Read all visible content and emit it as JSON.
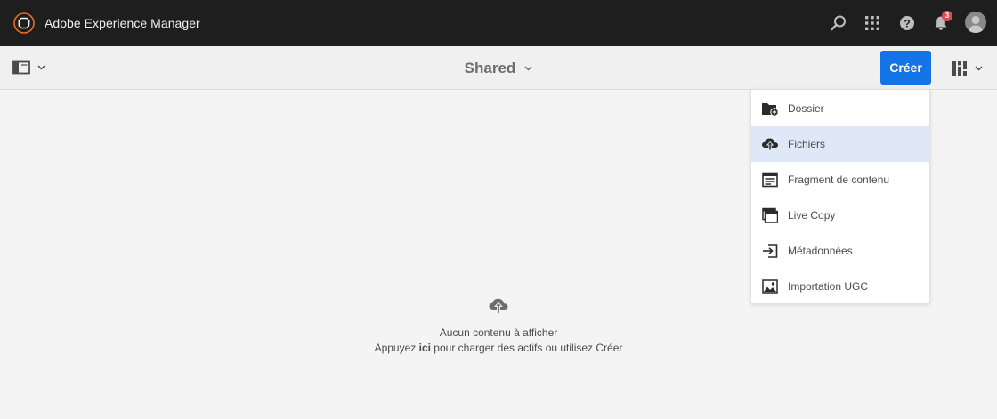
{
  "app": {
    "title": "Adobe Experience Manager",
    "logo_icon": "adobe-experience-manager-logo",
    "accent_color": "#eb6d1a"
  },
  "header_icons": {
    "search": "search-icon",
    "solutions": "apps-grid-icon",
    "help": "help-icon",
    "notifications": "bell-icon",
    "notification_count": "3",
    "user": "user-avatar"
  },
  "actionbar": {
    "rail_icon": "rail-toggle-icon",
    "title": "Shared",
    "create_label": "Créer",
    "create_color": "#1473e6",
    "view_icon": "card-view-icon"
  },
  "create_menu": {
    "items": [
      {
        "label": "Dossier",
        "icon": "folder-add-icon",
        "selected": false
      },
      {
        "label": "Fichiers",
        "icon": "upload-cloud-icon",
        "selected": true
      },
      {
        "label": "Fragment de contenu",
        "icon": "content-fragment-icon",
        "selected": false
      },
      {
        "label": "Live Copy",
        "icon": "live-copy-icon",
        "selected": false
      },
      {
        "label": "Métadonnées",
        "icon": "metadata-import-icon",
        "selected": false
      },
      {
        "label": "Importation UGC",
        "icon": "ugc-import-icon",
        "selected": false
      }
    ]
  },
  "empty_state": {
    "icon": "upload-cloud-icon",
    "message": "Aucun contenu à afficher",
    "hint_prefix": "Appuyez ",
    "hint_link": "ici",
    "hint_suffix": " pour charger des actifs ou utilisez Créer"
  }
}
